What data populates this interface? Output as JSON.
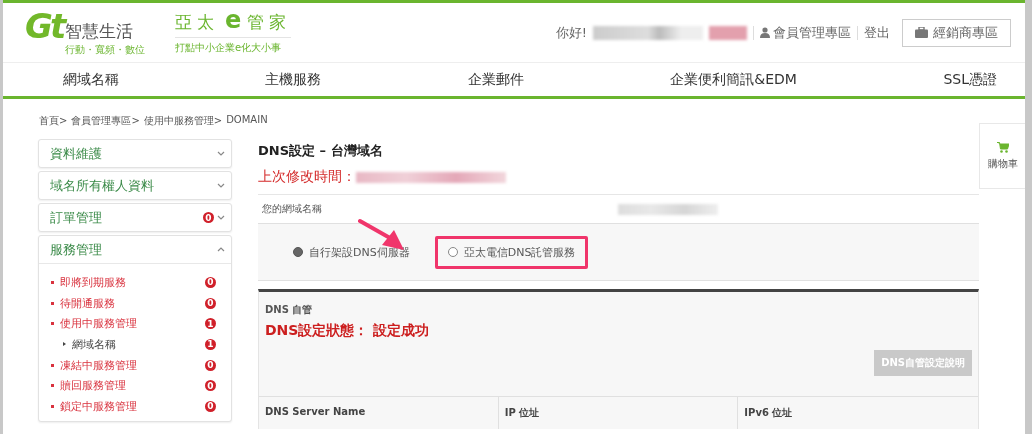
{
  "header": {
    "logo": {
      "mark": "Gt",
      "name": "智慧生活",
      "slogan": "行動・寬頻・數位"
    },
    "brand": {
      "parts": [
        {
          "text": "亞太",
          "kind": "plain"
        },
        {
          "text": "e",
          "kind": "accent"
        },
        {
          "text": "管家",
          "kind": "plain"
        }
      ],
      "tagline": "打點中小企業e化大小事"
    },
    "greeting": "你好!",
    "member_link": "會員管理專區",
    "logout": "登出",
    "dealer_button": "經銷商專區"
  },
  "nav": [
    "網域名稱",
    "主機服務",
    "企業郵件",
    "企業便利簡訊&EDM",
    "SSL憑證"
  ],
  "breadcrumb": [
    "首頁>",
    "會員管理專區>",
    "使用中服務管理>",
    "DOMAIN"
  ],
  "sidebar": {
    "items": [
      {
        "label": "資料維護",
        "expanded": false
      },
      {
        "label": "域名所有權人資料",
        "expanded": false
      },
      {
        "label": "訂單管理",
        "expanded": false,
        "badge": "0"
      },
      {
        "label": "服務管理",
        "expanded": true,
        "children": [
          {
            "label": "即將到期服務",
            "count": "0"
          },
          {
            "label": "待開通服務",
            "count": "0"
          },
          {
            "label": "使用中服務管理",
            "count": "1",
            "children": [
              {
                "label": "網域名稱",
                "count": "1"
              }
            ]
          },
          {
            "label": "凍結中服務管理",
            "count": "0"
          },
          {
            "label": "贖回服務管理",
            "count": "0"
          },
          {
            "label": "鎖定中服務管理",
            "count": "0"
          }
        ]
      }
    ]
  },
  "main": {
    "title": "DNS設定 – 台灣域名",
    "last_modified_label": "上次修改時間：",
    "domain_label": "您的網域名稱",
    "dns_options": [
      {
        "label": "自行架設DNS伺服器",
        "selected": true,
        "highlighted": false
      },
      {
        "label": "亞太電信DNS託管服務",
        "selected": false,
        "highlighted": true
      }
    ],
    "panel": {
      "heading": "DNS 自管",
      "status": "DNS設定狀態： 設定成功",
      "help_button": "DNS自管設定說明",
      "table": {
        "columns": [
          "DNS Server Name",
          "IP 位址",
          "IPv6 位址"
        ]
      }
    }
  },
  "cart": {
    "label": "購物車"
  }
}
